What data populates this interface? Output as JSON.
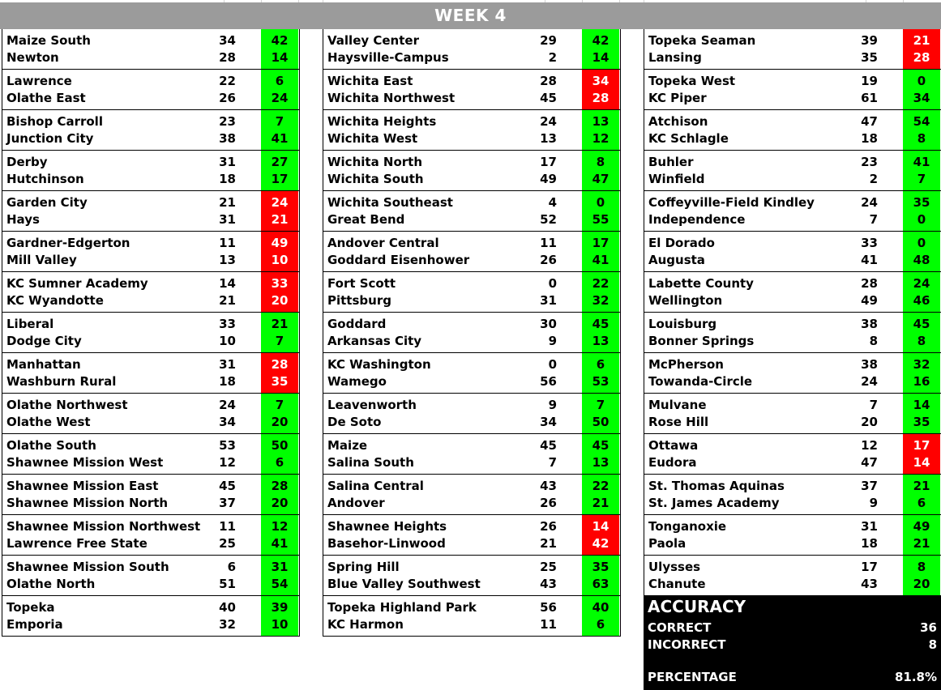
{
  "header": {
    "title": "WEEK 4"
  },
  "colors": {
    "correct": "#00ff00",
    "incorrect": "#ff0000",
    "banner": "#9b9b9b"
  },
  "columns": [
    {
      "games": [
        {
          "team1": "Maize South",
          "score1": "34",
          "pick1": "42",
          "team2": "Newton",
          "score2": "28",
          "pick2": "14",
          "result": "correct"
        },
        {
          "team1": "Lawrence",
          "score1": "22",
          "pick1": "6",
          "team2": "Olathe East",
          "score2": "26",
          "pick2": "24",
          "result": "correct"
        },
        {
          "team1": "Bishop Carroll",
          "score1": "23",
          "pick1": "7",
          "team2": "Junction City",
          "score2": "38",
          "pick2": "41",
          "result": "correct"
        },
        {
          "team1": "Derby",
          "score1": "31",
          "pick1": "27",
          "team2": "Hutchinson",
          "score2": "18",
          "pick2": "17",
          "result": "correct"
        },
        {
          "team1": "Garden City",
          "score1": "21",
          "pick1": "24",
          "team2": "Hays",
          "score2": "31",
          "pick2": "21",
          "result": "incorrect"
        },
        {
          "team1": "Gardner-Edgerton",
          "score1": "11",
          "pick1": "49",
          "team2": "Mill Valley",
          "score2": "13",
          "pick2": "10",
          "result": "incorrect"
        },
        {
          "team1": "KC Sumner Academy",
          "score1": "14",
          "pick1": "33",
          "team2": "KC Wyandotte",
          "score2": "21",
          "pick2": "20",
          "result": "incorrect"
        },
        {
          "team1": "Liberal",
          "score1": "33",
          "pick1": "21",
          "team2": "Dodge City",
          "score2": "10",
          "pick2": "7",
          "result": "correct"
        },
        {
          "team1": "Manhattan",
          "score1": "31",
          "pick1": "28",
          "team2": "Washburn Rural",
          "score2": "18",
          "pick2": "35",
          "result": "incorrect"
        },
        {
          "team1": "Olathe Northwest",
          "score1": "24",
          "pick1": "7",
          "team2": "Olathe West",
          "score2": "34",
          "pick2": "20",
          "result": "correct"
        },
        {
          "team1": "Olathe South",
          "score1": "53",
          "pick1": "50",
          "team2": "Shawnee Mission West",
          "score2": "12",
          "pick2": "6",
          "result": "correct"
        },
        {
          "team1": "Shawnee Mission East",
          "score1": "45",
          "pick1": "28",
          "team2": "Shawnee Mission North",
          "score2": "37",
          "pick2": "20",
          "result": "correct"
        },
        {
          "team1": "Shawnee Mission Northwest",
          "score1": "11",
          "pick1": "12",
          "team2": "Lawrence Free State",
          "score2": "25",
          "pick2": "41",
          "result": "correct"
        },
        {
          "team1": "Shawnee Mission South",
          "score1": "6",
          "pick1": "31",
          "team2": "Olathe North",
          "score2": "51",
          "pick2": "54",
          "result": "correct"
        },
        {
          "team1": "Topeka",
          "score1": "40",
          "pick1": "39",
          "team2": "Emporia",
          "score2": "32",
          "pick2": "10",
          "result": "correct"
        }
      ]
    },
    {
      "games": [
        {
          "team1": "Valley Center",
          "score1": "29",
          "pick1": "42",
          "team2": "Haysville-Campus",
          "score2": "2",
          "pick2": "14",
          "result": "correct"
        },
        {
          "team1": "Wichita East",
          "score1": "28",
          "pick1": "34",
          "team2": "Wichita Northwest",
          "score2": "45",
          "pick2": "28",
          "result": "incorrect"
        },
        {
          "team1": "Wichita Heights",
          "score1": "24",
          "pick1": "13",
          "team2": "Wichita West",
          "score2": "13",
          "pick2": "12",
          "result": "correct"
        },
        {
          "team1": "Wichita North",
          "score1": "17",
          "pick1": "8",
          "team2": "Wichita South",
          "score2": "49",
          "pick2": "47",
          "result": "correct"
        },
        {
          "team1": "Wichita Southeast",
          "score1": "4",
          "pick1": "0",
          "team2": "Great Bend",
          "score2": "52",
          "pick2": "55",
          "result": "correct"
        },
        {
          "team1": "Andover Central",
          "score1": "11",
          "pick1": "17",
          "team2": "Goddard Eisenhower",
          "score2": "26",
          "pick2": "41",
          "result": "correct"
        },
        {
          "team1": "Fort Scott",
          "score1": "0",
          "pick1": "22",
          "team2": "Pittsburg",
          "score2": "31",
          "pick2": "32",
          "result": "correct"
        },
        {
          "team1": "Goddard",
          "score1": "30",
          "pick1": "45",
          "team2": "Arkansas City",
          "score2": "9",
          "pick2": "13",
          "result": "correct"
        },
        {
          "team1": "KC Washington",
          "score1": "0",
          "pick1": "6",
          "team2": "Wamego",
          "score2": "56",
          "pick2": "53",
          "result": "correct"
        },
        {
          "team1": "Leavenworth",
          "score1": "9",
          "pick1": "7",
          "team2": "De Soto",
          "score2": "34",
          "pick2": "50",
          "result": "correct"
        },
        {
          "team1": "Maize",
          "score1": "45",
          "pick1": "45",
          "team2": "Salina South",
          "score2": "7",
          "pick2": "13",
          "result": "correct"
        },
        {
          "team1": "Salina Central",
          "score1": "43",
          "pick1": "22",
          "team2": "Andover",
          "score2": "26",
          "pick2": "21",
          "result": "correct"
        },
        {
          "team1": "Shawnee Heights",
          "score1": "26",
          "pick1": "14",
          "team2": "Basehor-Linwood",
          "score2": "21",
          "pick2": "42",
          "result": "incorrect"
        },
        {
          "team1": "Spring Hill",
          "score1": "25",
          "pick1": "35",
          "team2": "Blue Valley Southwest",
          "score2": "43",
          "pick2": "63",
          "result": "correct"
        },
        {
          "team1": "Topeka Highland Park",
          "score1": "56",
          "pick1": "40",
          "team2": "KC Harmon",
          "score2": "11",
          "pick2": "6",
          "result": "correct"
        }
      ]
    },
    {
      "games": [
        {
          "team1": "Topeka Seaman",
          "score1": "39",
          "pick1": "21",
          "team2": "Lansing",
          "score2": "35",
          "pick2": "28",
          "result": "incorrect"
        },
        {
          "team1": "Topeka West",
          "score1": "19",
          "pick1": "0",
          "team2": "KC Piper",
          "score2": "61",
          "pick2": "34",
          "result": "correct"
        },
        {
          "team1": "Atchison",
          "score1": "47",
          "pick1": "54",
          "team2": "KC Schlagle",
          "score2": "18",
          "pick2": "8",
          "result": "correct"
        },
        {
          "team1": "Buhler",
          "score1": "23",
          "pick1": "41",
          "team2": "Winfield",
          "score2": "2",
          "pick2": "7",
          "result": "correct"
        },
        {
          "team1": "Coffeyville-Field Kindley",
          "score1": "24",
          "pick1": "35",
          "team2": "Independence",
          "score2": "7",
          "pick2": "0",
          "result": "correct"
        },
        {
          "team1": "El Dorado",
          "score1": "33",
          "pick1": "0",
          "team2": "Augusta",
          "score2": "41",
          "pick2": "48",
          "result": "correct"
        },
        {
          "team1": "Labette County",
          "score1": "28",
          "pick1": "24",
          "team2": "Wellington",
          "score2": "49",
          "pick2": "46",
          "result": "correct"
        },
        {
          "team1": "Louisburg",
          "score1": "38",
          "pick1": "45",
          "team2": "Bonner Springs",
          "score2": "8",
          "pick2": "8",
          "result": "correct"
        },
        {
          "team1": "McPherson",
          "score1": "38",
          "pick1": "32",
          "team2": "Towanda-Circle",
          "score2": "24",
          "pick2": "16",
          "result": "correct"
        },
        {
          "team1": "Mulvane",
          "score1": "7",
          "pick1": "14",
          "team2": "Rose Hill",
          "score2": "20",
          "pick2": "35",
          "result": "correct"
        },
        {
          "team1": "Ottawa",
          "score1": "12",
          "pick1": "17",
          "team2": "Eudora",
          "score2": "47",
          "pick2": "14",
          "result": "incorrect"
        },
        {
          "team1": "St. Thomas Aquinas",
          "score1": "37",
          "pick1": "21",
          "team2": "St. James Academy",
          "score2": "9",
          "pick2": "6",
          "result": "correct"
        },
        {
          "team1": "Tonganoxie",
          "score1": "31",
          "pick1": "49",
          "team2": "Paola",
          "score2": "18",
          "pick2": "21",
          "result": "correct"
        },
        {
          "team1": "Ulysses",
          "score1": "17",
          "pick1": "8",
          "team2": "Chanute",
          "score2": "43",
          "pick2": "20",
          "result": "correct"
        }
      ]
    }
  ],
  "accuracy": {
    "title": "ACCURACY",
    "correct_label": "CORRECT",
    "correct_value": "36",
    "incorrect_label": "INCORRECT",
    "incorrect_value": "8",
    "percentage_label": "PERCENTAGE",
    "percentage_value": "81.8%"
  }
}
